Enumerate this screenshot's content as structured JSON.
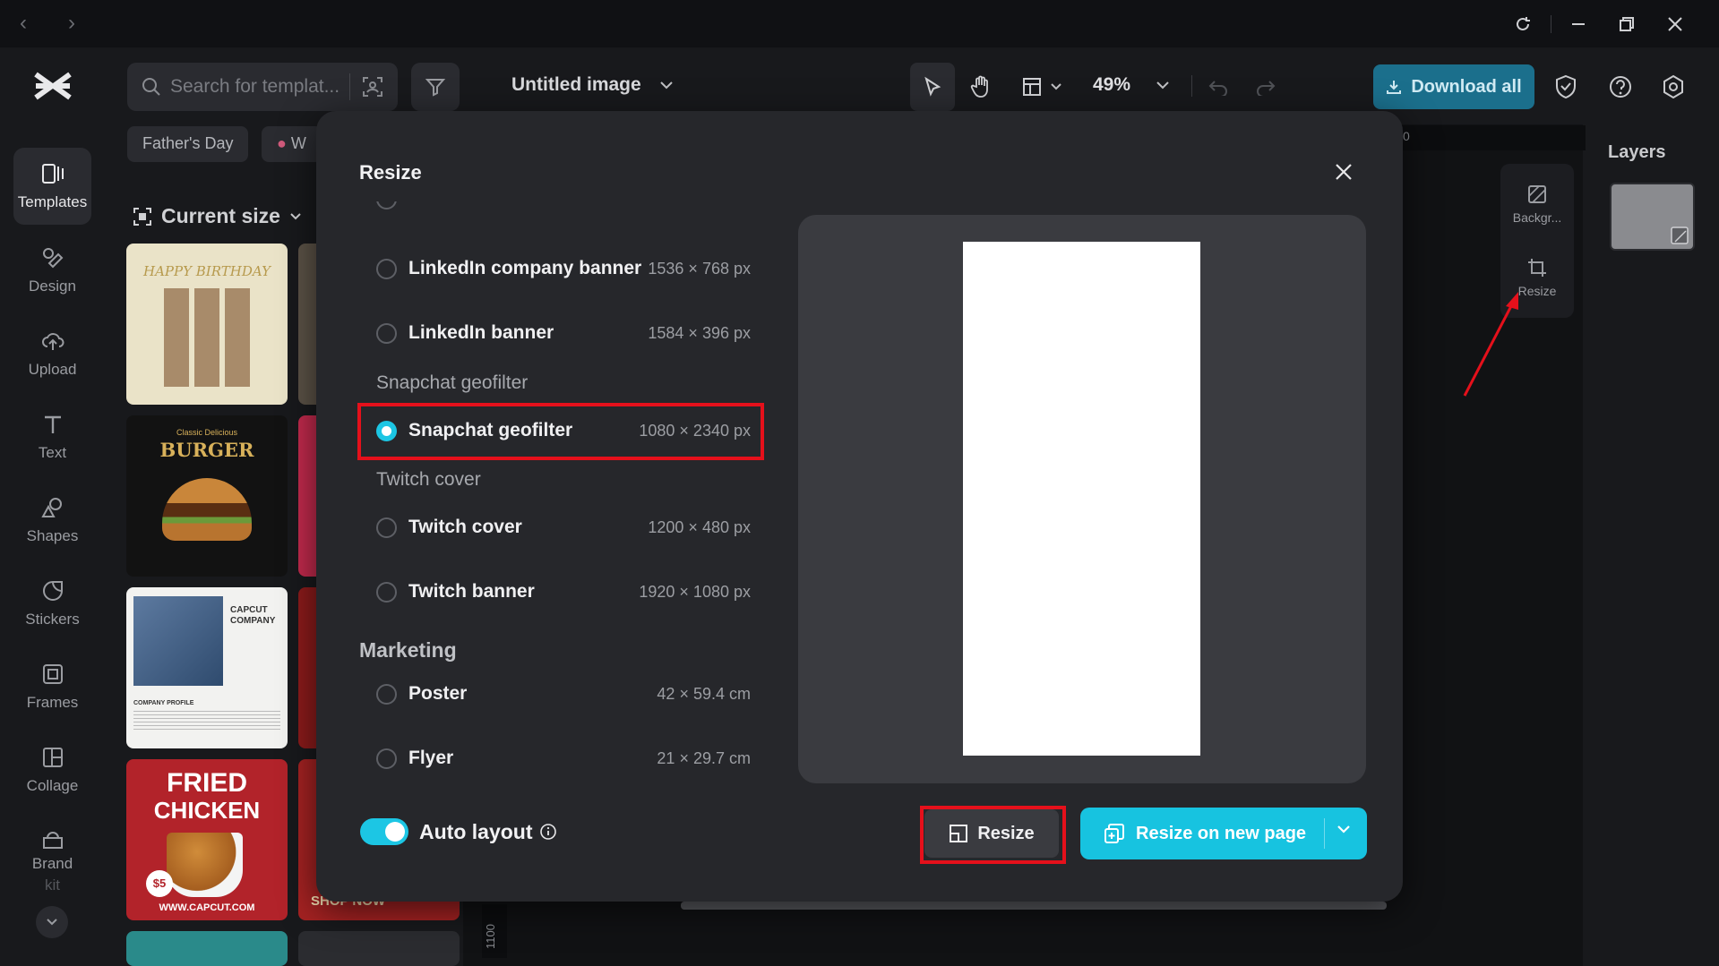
{
  "app": {
    "doc_title": "Untitled image",
    "zoom": "49%",
    "download_label": "Download all",
    "search_placeholder": "Search for templat..."
  },
  "panel": {
    "chips": [
      "Father's Day",
      "W"
    ],
    "current_size_label": "Current size"
  },
  "rail": {
    "items": [
      {
        "label": "Templates",
        "icon": "templates-icon"
      },
      {
        "label": "Design",
        "icon": "design-icon"
      },
      {
        "label": "Upload",
        "icon": "upload-icon"
      },
      {
        "label": "Text",
        "icon": "text-icon"
      },
      {
        "label": "Shapes",
        "icon": "shapes-icon"
      },
      {
        "label": "Stickers",
        "icon": "stickers-icon"
      },
      {
        "label": "Frames",
        "icon": "frames-icon"
      },
      {
        "label": "Collage",
        "icon": "collage-icon"
      },
      {
        "label": "Brand",
        "icon": "brand-kit-icon"
      }
    ],
    "brand_sub": "kit"
  },
  "thumbs": {
    "t1": "HAPPY BIRTHDAY",
    "t2_top": "Classic Delicious",
    "t2": "BURGER",
    "t3_a": "CAPCUT",
    "t3_b": "COMPANY",
    "t3_c": "COMPANY PROFILE",
    "t4_a": "FRIED",
    "t4_b": "CHICKEN",
    "t4_price": "$5",
    "t4_url": "WWW.CAPCUT.COM",
    "t5": "SHOP NOW"
  },
  "side_tools": {
    "background_label": "Backgr...",
    "resize_label": "Resize"
  },
  "layers": {
    "title": "Layers"
  },
  "ruler": {
    "mark": "0",
    "v_mark": "1100"
  },
  "modal": {
    "title": "Resize",
    "options": [
      {
        "name": "LinkedIn company banner",
        "dims": "1536 × 768 px",
        "selected": false
      },
      {
        "name": "LinkedIn banner",
        "dims": "1584 × 396 px",
        "selected": false
      },
      {
        "name": "Snapchat geofilter",
        "dims": "1080 × 2340 px",
        "selected": true
      },
      {
        "name": "Twitch cover",
        "dims": "1200 × 480 px",
        "selected": false
      },
      {
        "name": "Twitch banner",
        "dims": "1920 × 1080 px",
        "selected": false
      },
      {
        "name": "Poster",
        "dims": "42 × 59.4 cm",
        "selected": false
      },
      {
        "name": "Flyer",
        "dims": "21 × 29.7 cm",
        "selected": false
      }
    ],
    "subheads": {
      "snapchat": "Snapchat geofilter",
      "twitch": "Twitch cover"
    },
    "section_marketing": "Marketing",
    "auto_layout_label": "Auto layout",
    "auto_layout_on": true,
    "resize_label": "Resize",
    "resize_new_label": "Resize on new page"
  },
  "colors": {
    "accent": "#1cc6e4",
    "highlight": "#e5101b",
    "download": "#1b6f8c"
  }
}
